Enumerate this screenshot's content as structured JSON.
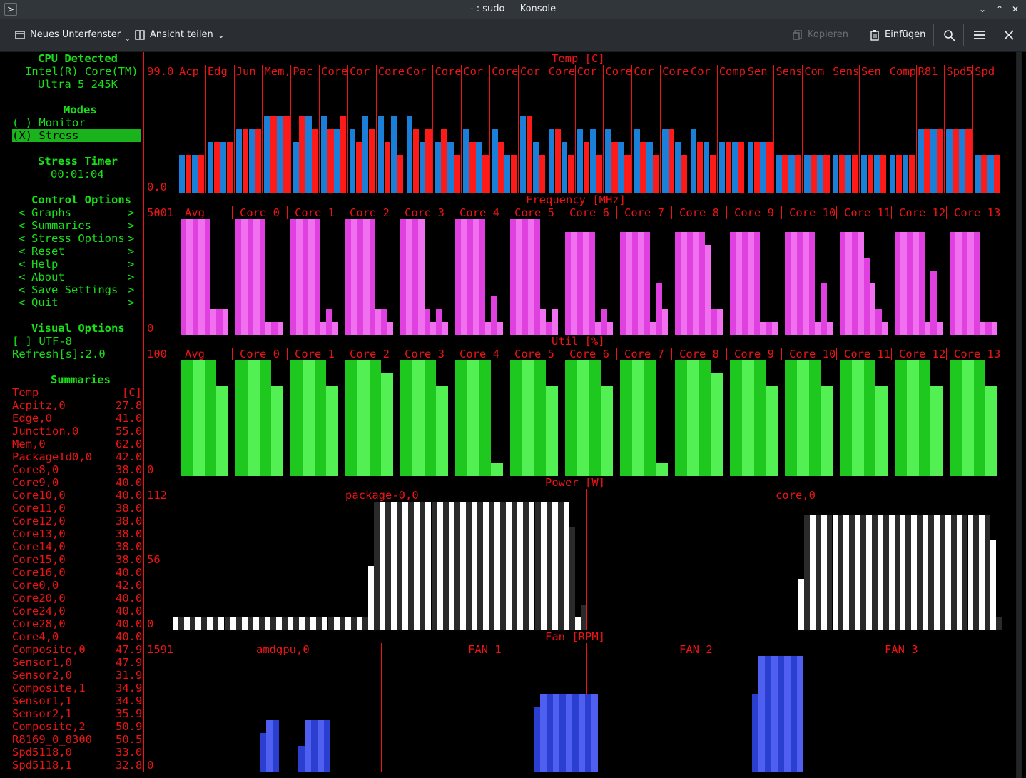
{
  "window": {
    "title": "- : sudo — Konsole"
  },
  "toolbar": {
    "new_tab": "Neues Unterfenster",
    "split_view": "Ansicht teilen",
    "copy": "Kopieren",
    "paste": "Einfügen"
  },
  "colors": {
    "green": "#18e018",
    "red": "#ee1414",
    "magenta1": "#e040e0",
    "magenta2": "#f070f0",
    "blue1": "#1a7fd8",
    "blue2": "#ff1a1a",
    "fan1": "#2a3fd0",
    "fan2": "#4f5ff0"
  },
  "sidebar": {
    "cpu_title": "CPU Detected",
    "cpu_name1": "Intel(R) Core(TM)",
    "cpu_name2": "Ultra 5 245K",
    "modes_title": "Modes",
    "mode_monitor": "( ) Monitor",
    "mode_stress": "(X) Stress",
    "timer_title": "Stress Timer",
    "timer_value": "00:01:04",
    "control_title": "Control Options",
    "control_items": [
      "Graphs",
      "Summaries",
      "Stress Options",
      "Reset",
      "Help",
      "About",
      "Save Settings",
      "Quit"
    ],
    "visual_title": "Visual Options",
    "utf8": "[ ] UTF-8",
    "refresh": "Refresh[s]:2.0",
    "summaries_title": "Summaries",
    "summary_header": {
      "name": "Temp",
      "unit": "[C]"
    },
    "summary_rows": [
      [
        "Acpitz,0",
        "27.8"
      ],
      [
        "Edge,0",
        "41.0"
      ],
      [
        "Junction,0",
        "55.0"
      ],
      [
        "Mem,0",
        "62.0"
      ],
      [
        "PackageId0,0",
        "42.0"
      ],
      [
        "Core8,0",
        "38.0"
      ],
      [
        "Core9,0",
        "40.0"
      ],
      [
        "Core10,0",
        "40.0"
      ],
      [
        "Core11,0",
        "38.0"
      ],
      [
        "Core12,0",
        "38.0"
      ],
      [
        "Core13,0",
        "38.0"
      ],
      [
        "Core14,0",
        "38.0"
      ],
      [
        "Core15,0",
        "38.0"
      ],
      [
        "Core16,0",
        "40.0"
      ],
      [
        "Core0,0",
        "42.0"
      ],
      [
        "Core20,0",
        "40.0"
      ],
      [
        "Core24,0",
        "40.0"
      ],
      [
        "Core28,0",
        "40.0"
      ],
      [
        "Core4,0",
        "40.0"
      ],
      [
        "Composite,0",
        "47.9"
      ],
      [
        "Sensor1,0",
        "47.9"
      ],
      [
        "Sensor2,0",
        "31.9"
      ],
      [
        "Composite,1",
        "34.9"
      ],
      [
        "Sensor1,1",
        "34.9"
      ],
      [
        "Sensor2,1",
        "35.9"
      ],
      [
        "Composite,2",
        "50.9"
      ],
      [
        "R8169_0_8300",
        "50.5"
      ],
      [
        "Spd5118,0",
        "33.0"
      ],
      [
        "Spd5118,1",
        "32.8"
      ]
    ]
  },
  "temp": {
    "title": "Temp [C]",
    "ymax": "99.0",
    "ymin": "0.0",
    "labels": [
      "Acp",
      "Edg",
      "Jun",
      "Mem,",
      "Pac",
      "Core",
      "Cor",
      "Core",
      "Cor",
      "Core",
      "Cor",
      "Core",
      "Cor",
      "Core",
      "Cor",
      "Core",
      "Cor",
      "Core",
      "Cor",
      "Comp",
      "Sen",
      "Sens",
      "Com",
      "Sens",
      "Sen",
      "Comp",
      "R81",
      "Spd5",
      "Spd"
    ],
    "levels": [
      [
        3,
        3,
        3,
        3
      ],
      [
        4,
        4,
        4,
        4
      ],
      [
        5,
        5,
        5,
        5
      ],
      [
        6,
        6,
        6,
        6
      ],
      [
        4,
        6,
        6,
        5
      ],
      [
        6,
        5,
        5,
        6
      ],
      [
        5,
        4,
        6,
        5
      ],
      [
        6,
        4,
        6,
        3
      ],
      [
        6,
        5,
        4,
        5
      ],
      [
        4,
        5,
        4,
        3
      ],
      [
        5,
        4,
        4,
        3
      ],
      [
        5,
        4,
        3,
        3
      ],
      [
        6,
        6,
        4,
        3
      ],
      [
        5,
        5,
        4,
        3
      ],
      [
        5,
        4,
        5,
        3
      ],
      [
        5,
        4,
        4,
        3
      ],
      [
        5,
        4,
        4,
        3
      ],
      [
        5,
        5,
        4,
        3
      ],
      [
        5,
        4,
        4,
        3
      ],
      [
        4,
        4,
        4,
        4
      ],
      [
        4,
        4,
        4,
        4
      ],
      [
        3,
        3,
        3,
        3
      ],
      [
        3,
        3,
        3,
        3
      ],
      [
        3,
        3,
        3,
        3
      ],
      [
        3,
        3,
        3,
        3
      ],
      [
        3,
        3,
        3,
        3
      ],
      [
        5,
        5,
        5,
        5
      ],
      [
        5,
        5,
        5,
        5
      ],
      [
        3,
        3,
        3,
        3
      ]
    ]
  },
  "freq": {
    "title": "Frequency [MHz]",
    "ymax": "5001",
    "ymin": "0",
    "labels": [
      "Avg",
      "Core 0",
      "Core 1",
      "Core 2",
      "Core 3",
      "Core 4",
      "Core 5",
      "Core 6",
      "Core 7",
      "Core 8",
      "Core 9",
      "Core 10",
      "Core 11",
      "Core 12",
      "Core 13"
    ],
    "levels": [
      [
        9,
        9,
        9,
        9,
        9,
        2,
        2,
        2
      ],
      [
        9,
        9,
        9,
        9,
        9,
        1,
        1,
        1
      ],
      [
        9,
        9,
        9,
        9,
        9,
        1,
        2,
        1
      ],
      [
        9,
        9,
        9,
        9,
        9,
        2,
        2,
        1
      ],
      [
        9,
        9,
        9,
        9,
        2,
        1,
        2,
        1
      ],
      [
        9,
        9,
        9,
        9,
        9,
        1,
        3,
        1
      ],
      [
        9,
        9,
        9,
        9,
        9,
        2,
        1,
        2
      ],
      [
        8,
        8,
        8,
        8,
        8,
        1,
        2,
        1
      ],
      [
        8,
        8,
        8,
        8,
        8,
        1,
        4,
        2
      ],
      [
        8,
        8,
        8,
        8,
        8,
        7,
        2,
        2
      ],
      [
        8,
        8,
        8,
        8,
        8,
        1,
        1,
        1
      ],
      [
        8,
        8,
        8,
        8,
        8,
        1,
        4,
        1
      ],
      [
        8,
        8,
        8,
        8,
        6,
        4,
        2,
        1
      ],
      [
        8,
        8,
        8,
        8,
        8,
        1,
        5,
        1
      ],
      [
        8,
        8,
        8,
        8,
        8,
        1,
        1,
        1
      ]
    ]
  },
  "util": {
    "title": "Util [%]",
    "ymax": "100",
    "ymin": "0",
    "labels": [
      "Avg",
      "Core 0",
      "Core 1",
      "Core 2",
      "Core 3",
      "Core 4",
      "Core 5",
      "Core 6",
      "Core 7",
      "Core 8",
      "Core 9",
      "Core 10",
      "Core 11",
      "Core 12",
      "Core 13"
    ],
    "levels": [
      [
        9,
        9,
        9,
        7
      ],
      [
        9,
        9,
        9,
        7
      ],
      [
        9,
        9,
        9,
        7
      ],
      [
        9,
        9,
        9,
        8
      ],
      [
        9,
        9,
        9,
        7
      ],
      [
        9,
        9,
        9,
        1
      ],
      [
        9,
        9,
        9,
        7
      ],
      [
        9,
        9,
        9,
        7
      ],
      [
        9,
        9,
        9,
        1
      ],
      [
        9,
        9,
        9,
        8
      ],
      [
        9,
        9,
        9,
        7
      ],
      [
        9,
        9,
        9,
        7
      ],
      [
        9,
        9,
        9,
        7
      ],
      [
        9,
        9,
        9,
        7
      ],
      [
        9,
        9,
        9,
        7
      ]
    ]
  },
  "power": {
    "title": "Power [W]",
    "ymax": "112",
    "ymid": "56",
    "ymin": "0",
    "series": [
      {
        "name": "package-0,0",
        "levels": [
          1,
          1,
          1,
          1,
          1,
          1,
          1,
          1,
          1,
          1,
          1,
          1,
          1,
          1,
          1,
          1,
          1,
          1,
          1,
          1,
          1,
          1,
          1,
          1,
          1,
          1,
          1,
          1,
          1,
          1,
          1,
          1,
          1,
          1,
          5,
          10,
          10,
          10,
          10,
          10,
          10,
          10,
          10,
          10,
          10,
          10,
          10,
          10,
          10,
          10,
          10,
          10,
          10,
          10,
          10,
          10,
          10,
          10,
          10,
          10,
          10,
          10,
          10,
          10,
          10,
          10,
          10,
          10,
          10,
          8,
          1,
          2
        ]
      },
      {
        "name": "core,0",
        "levels": [
          0,
          0,
          0,
          0,
          0,
          0,
          0,
          0,
          0,
          0,
          0,
          0,
          0,
          0,
          0,
          0,
          0,
          0,
          0,
          0,
          0,
          0,
          0,
          0,
          0,
          0,
          0,
          0,
          0,
          0,
          0,
          0,
          0,
          0,
          0,
          0,
          4,
          9,
          9,
          9,
          9,
          9,
          9,
          9,
          9,
          9,
          9,
          9,
          9,
          9,
          9,
          9,
          9,
          9,
          9,
          9,
          9,
          9,
          9,
          9,
          9,
          9,
          9,
          9,
          9,
          9,
          9,
          9,
          9,
          9,
          7,
          1
        ]
      }
    ]
  },
  "fan": {
    "title": "Fan [RPM]",
    "ymax": "1591",
    "ymin": "0",
    "series": [
      {
        "name": "amdgpu,0",
        "start": 14,
        "levels": [
          3,
          4,
          4,
          0,
          0,
          0,
          2,
          4,
          4,
          4,
          4
        ]
      },
      {
        "name": "FAN 1",
        "start": 24,
        "levels": [
          5,
          6,
          6,
          6,
          6,
          6,
          6,
          6,
          6,
          6
        ]
      },
      {
        "name": "FAN 2",
        "start": 26,
        "levels": [
          6,
          9,
          9,
          9,
          9,
          9,
          9,
          9
        ]
      },
      {
        "name": "FAN 3",
        "start": 0,
        "levels": []
      }
    ]
  }
}
